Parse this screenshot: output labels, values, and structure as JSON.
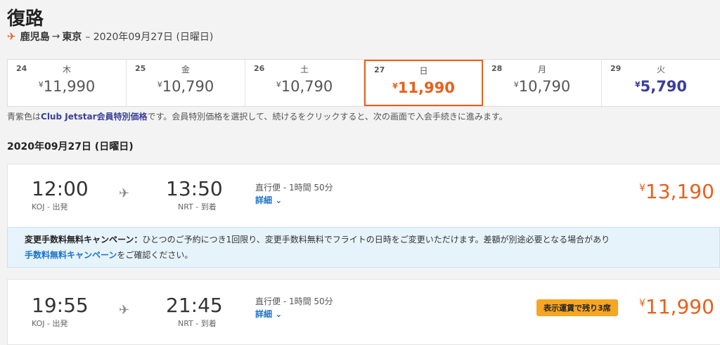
{
  "page": {
    "title": "復路",
    "route_from": "鹿児島",
    "route_arrow": "→",
    "route_to": "東京",
    "route_date": "– 2020年09月27日 (日曜日)"
  },
  "dates": [
    {
      "day": "24",
      "weekday": "木",
      "yen": "¥",
      "price": "11,990",
      "state": "normal"
    },
    {
      "day": "25",
      "weekday": "金",
      "yen": "¥",
      "price": "10,790",
      "state": "normal"
    },
    {
      "day": "26",
      "weekday": "土",
      "yen": "¥",
      "price": "10,790",
      "state": "normal"
    },
    {
      "day": "27",
      "weekday": "日",
      "yen": "¥",
      "price": "11,990",
      "state": "selected"
    },
    {
      "day": "28",
      "weekday": "月",
      "yen": "¥",
      "price": "10,790",
      "state": "normal"
    },
    {
      "day": "29",
      "weekday": "火",
      "yen": "¥",
      "price": "5,790",
      "state": "member"
    }
  ],
  "note": {
    "prefix": "青紫色は",
    "bold": "Club Jetstar会員特別価格",
    "suffix": "です。会員特別価格を選択して、続けるをクリックすると、次の画面で入会手続きに進みます。"
  },
  "day_title": "2020年09月27日 (日曜日)",
  "flights": [
    {
      "dep_time": "12:00",
      "dep_airport": "KOJ - 出発",
      "arr_time": "13:50",
      "arr_airport": "NRT - 到着",
      "duration": "直行便 - 1時間 50分",
      "detail": "詳細",
      "yen": "¥",
      "price": "13,190",
      "badge": ""
    },
    {
      "dep_time": "19:55",
      "dep_airport": "KOJ - 出発",
      "arr_time": "21:45",
      "arr_airport": "NRT - 到着",
      "duration": "直行便 - 1時間 50分",
      "detail": "詳細",
      "yen": "¥",
      "price": "11,990",
      "badge": "表示運賃で残り3席"
    }
  ],
  "campaign": {
    "bold": "変更手数料無料キャンペーン：",
    "text": "ひとつのご予約につき1回限り、変更手数料無料でフライトの日時をご変更いただけます。差額が別途必要となる場合があり",
    "link": "手数料無料キャンペーン",
    "suffix": "をご確認ください。"
  },
  "colors": {
    "accent": "#e8601c",
    "member": "#3b3e9a",
    "link": "#1a73c9",
    "badge": "#f5a623"
  }
}
